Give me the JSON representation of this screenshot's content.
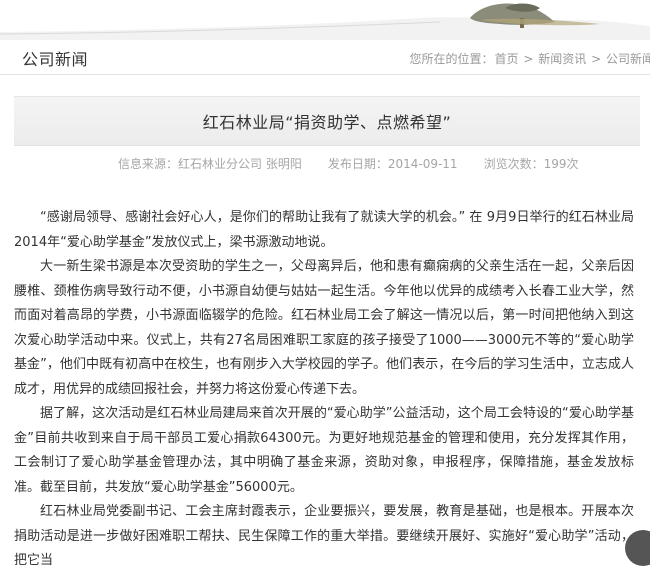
{
  "header": {
    "section_title": "公司新闻",
    "breadcrumb": {
      "prefix": "您所在的位置：",
      "items": [
        "首页",
        "新闻资讯",
        "公司新闻"
      ],
      "separator": ">"
    }
  },
  "article": {
    "title": "红石林业局“捐资助学、点燃希望”",
    "meta": {
      "source": "信息来源：红石林业分公司 张明阳",
      "date": "发布日期：2014-09-11",
      "views": "浏览次数：199次"
    },
    "paragraphs": [
      "“感谢局领导、感谢社会好心人，是你们的帮助让我有了就读大学的机会。” 在 9月9日举行的红石林业局2014年“爱心助学基金”发放仪式上，梁书源激动地说。",
      "大一新生梁书源是本次受资助的学生之一，父母离异后，他和患有癫痫病的父亲生活在一起，父亲后因腰椎、颈椎伤病导致行动不便，小书源自幼便与姑姑一起生活。今年他以优异的成绩考入长春工业大学，然而面对着高昂的学费，小书源面临辍学的危险。红石林业局工会了解这一情况以后，第一时间把他纳入到这次爱心助学活动中来。仪式上，共有27名局困难职工家庭的孩子接受了1000——3000元不等的“爱心助学基金”，他们中既有初高中在校生，也有刚步入大学校园的学子。他们表示，在今后的学习生活中，立志成人成才，用优异的成绩回报社会，并努力将这份爱心传递下去。",
      "据了解，这次活动是红石林业局建局来首次开展的“爱心助学”公益活动，这个局工会特设的“爱心助学基金”目前共收到来自于局干部员工爱心捐款64300元。为更好地规范基金的管理和使用，充分发挥其作用，工会制订了爱心助学基金管理办法，其中明确了基金来源，资助对象，申报程序，保障措施，基金发放标准。截至目前，共发放“爱心助学基金”56000元。",
      "红石林业局党委副书记、工会主席封霞表示，企业要振兴，要发展，教育是基础，也是根本。开展本次捐助活动是进一步做好困难职工帮扶、民生保障工作的重大举措。要继续开展好、实施好“爱心助学”活动，把它当"
    ]
  },
  "colors": {
    "text": "#333333",
    "muted": "#999999",
    "meta": "#a6a6a6",
    "band": "#efefef",
    "divider": "#e3e3e3"
  }
}
